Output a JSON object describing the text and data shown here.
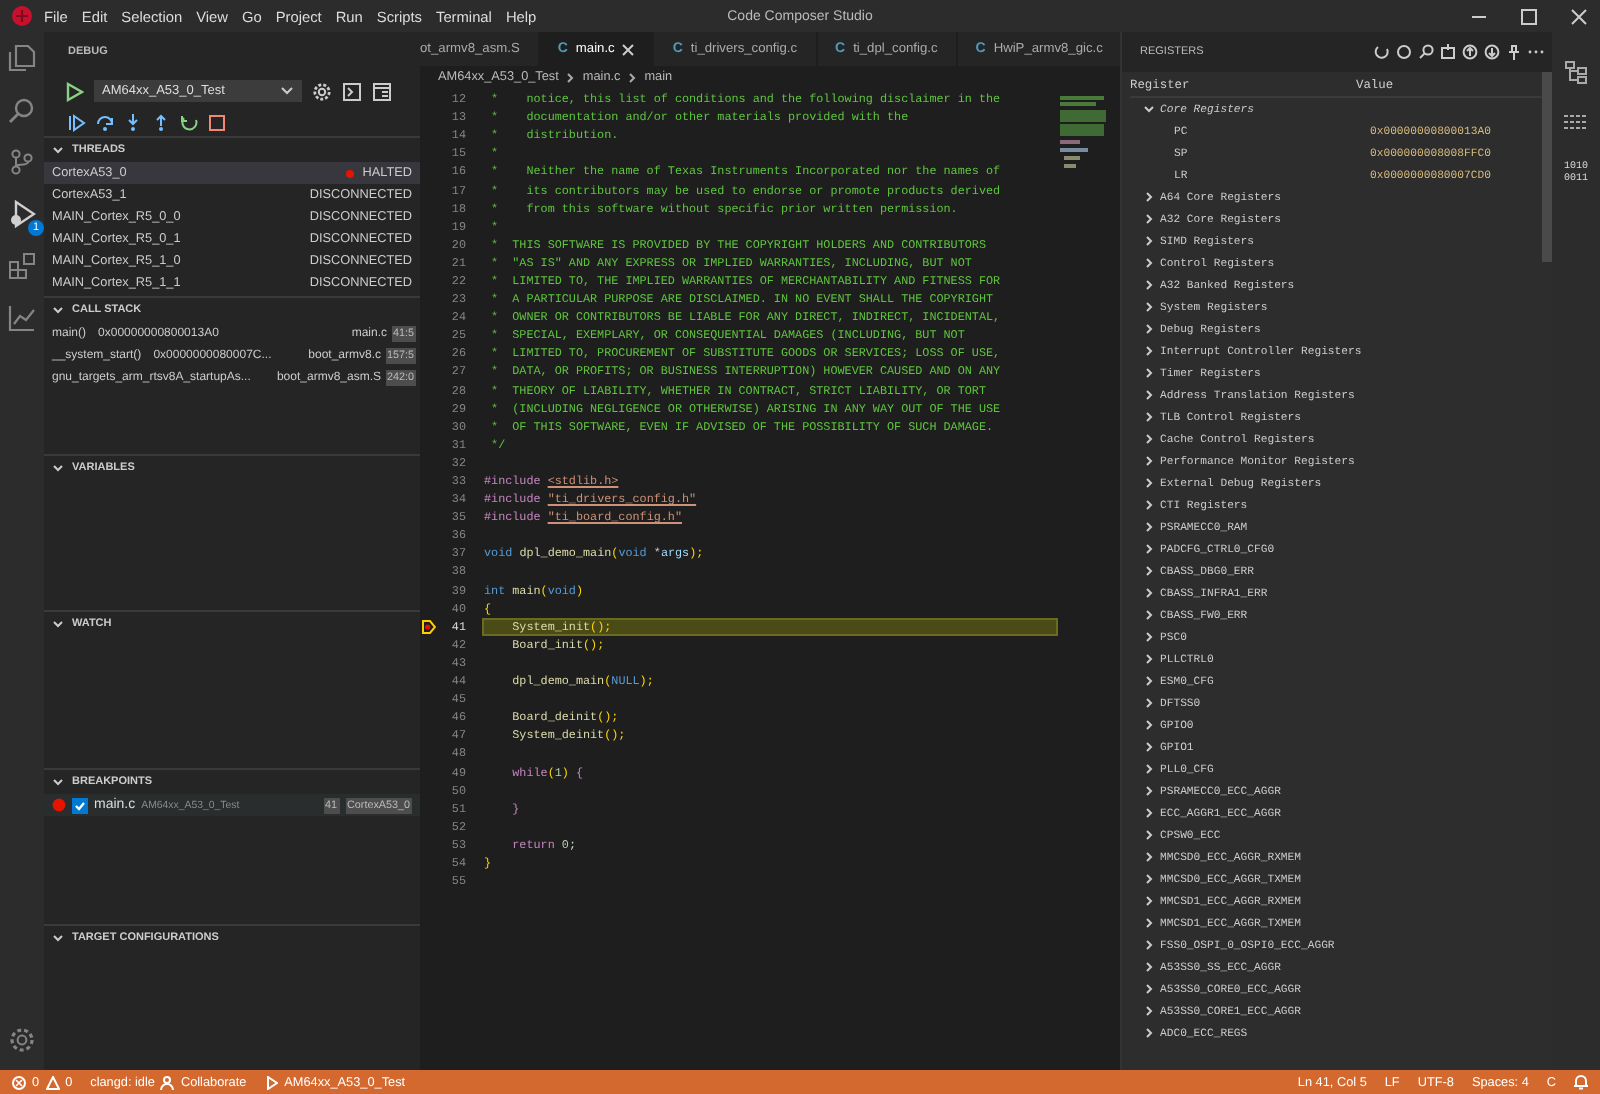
{
  "window": {
    "title": "Code Composer Studio"
  },
  "menu": [
    "File",
    "Edit",
    "Selection",
    "View",
    "Go",
    "Project",
    "Run",
    "Scripts",
    "Terminal",
    "Help"
  ],
  "activity_badge": "1",
  "debug": {
    "title": "DEBUG",
    "config": "AM64xx_A53_0_Test",
    "sections": [
      {
        "kind": "threads",
        "title": "THREADS",
        "expanded": true
      },
      {
        "kind": "callstack",
        "title": "CALL STACK",
        "expanded": true
      },
      {
        "kind": "variables",
        "title": "VARIABLES",
        "expanded": true
      },
      {
        "kind": "watch",
        "title": "WATCH",
        "expanded": true
      },
      {
        "kind": "breakpoints",
        "title": "BREAKPOINTS",
        "expanded": true
      },
      {
        "kind": "targets",
        "title": "TARGET CONFIGURATIONS",
        "expanded": true
      }
    ],
    "threads": [
      {
        "name": "CortexA53_0",
        "status": "HALTED",
        "halted": true,
        "selected": true
      },
      {
        "name": "CortexA53_1",
        "status": "DISCONNECTED",
        "halted": false,
        "selected": false
      },
      {
        "name": "MAIN_Cortex_R5_0_0",
        "status": "DISCONNECTED",
        "halted": false,
        "selected": false
      },
      {
        "name": "MAIN_Cortex_R5_0_1",
        "status": "DISCONNECTED",
        "halted": false,
        "selected": false
      },
      {
        "name": "MAIN_Cortex_R5_1_0",
        "status": "DISCONNECTED",
        "halted": false,
        "selected": false
      },
      {
        "name": "MAIN_Cortex_R5_1_1",
        "status": "DISCONNECTED",
        "halted": false,
        "selected": false
      }
    ],
    "call_stack": [
      {
        "function": "main()",
        "address": "0x00000000800013A0",
        "file": "main.c",
        "position": "41:5"
      },
      {
        "function": "__system_start()",
        "address": "0x0000000080007C...",
        "file": "boot_armv8.c",
        "position": "157:5"
      },
      {
        "function": "gnu_targets_arm_rtsv8A_startupAs...",
        "file": "boot_armv8_asm.S",
        "position": "242:0"
      }
    ],
    "breakpoints": [
      {
        "file": "main.c",
        "project": "AM64xx_A53_0_Test",
        "line": "41",
        "core": "CortexA53_0",
        "checked": true
      }
    ]
  },
  "editor": {
    "tabs": [
      {
        "label": "ot_armv8_asm.S",
        "selected": false
      },
      {
        "label": "main.c",
        "icon": "C",
        "selected": true
      },
      {
        "label": "ti_drivers_config.c",
        "icon": "C",
        "selected": false
      },
      {
        "label": "ti_dpl_config.c",
        "icon": "C",
        "selected": false
      },
      {
        "label": "HwiP_armv8_gic.c",
        "icon": "C",
        "selected": false
      }
    ],
    "breadcrumb": [
      "AM64xx_A53_0_Test",
      "main.c",
      "main"
    ],
    "lines": [
      {
        "number": "12",
        "current": false,
        "tokens": [
          {
            "kind": "comment",
            "text": " *    notice, this list of conditions and the following disclaimer in the"
          }
        ]
      },
      {
        "number": "13",
        "current": false,
        "tokens": [
          {
            "kind": "comment",
            "text": " *    documentation and/or other materials provided with the"
          }
        ]
      },
      {
        "number": "14",
        "current": false,
        "tokens": [
          {
            "kind": "comment",
            "text": " *    distribution."
          }
        ]
      },
      {
        "number": "15",
        "current": false,
        "tokens": [
          {
            "kind": "comment",
            "text": " *"
          }
        ]
      },
      {
        "number": "16",
        "current": false,
        "tokens": [
          {
            "kind": "comment",
            "text": " *    Neither the name of Texas Instruments Incorporated nor the names of"
          }
        ]
      },
      {
        "number": "17",
        "current": false,
        "tokens": [
          {
            "kind": "comment",
            "text": " *    its contributors may be used to endorse or promote products derived"
          }
        ]
      },
      {
        "number": "18",
        "current": false,
        "tokens": [
          {
            "kind": "comment",
            "text": " *    from this software without specific prior written permission."
          }
        ]
      },
      {
        "number": "19",
        "current": false,
        "tokens": [
          {
            "kind": "comment",
            "text": " *"
          }
        ]
      },
      {
        "number": "20",
        "current": false,
        "tokens": [
          {
            "kind": "comment",
            "text": " *  THIS SOFTWARE IS PROVIDED BY THE COPYRIGHT HOLDERS AND CONTRIBUTORS"
          }
        ]
      },
      {
        "number": "21",
        "current": false,
        "tokens": [
          {
            "kind": "comment",
            "text": " *  \"AS IS\" AND ANY EXPRESS OR IMPLIED WARRANTIES, INCLUDING, BUT NOT"
          }
        ]
      },
      {
        "number": "22",
        "current": false,
        "tokens": [
          {
            "kind": "comment",
            "text": " *  LIMITED TO, THE IMPLIED WARRANTIES OF MERCHANTABILITY AND FITNESS FOR"
          }
        ]
      },
      {
        "number": "23",
        "current": false,
        "tokens": [
          {
            "kind": "comment",
            "text": " *  A PARTICULAR PURPOSE ARE DISCLAIMED. IN NO EVENT SHALL THE COPYRIGHT"
          }
        ]
      },
      {
        "number": "24",
        "current": false,
        "tokens": [
          {
            "kind": "comment",
            "text": " *  OWNER OR CONTRIBUTORS BE LIABLE FOR ANY DIRECT, INDIRECT, INCIDENTAL,"
          }
        ]
      },
      {
        "number": "25",
        "current": false,
        "tokens": [
          {
            "kind": "comment",
            "text": " *  SPECIAL, EXEMPLARY, OR CONSEQUENTIAL DAMAGES (INCLUDING, BUT NOT"
          }
        ]
      },
      {
        "number": "26",
        "current": false,
        "tokens": [
          {
            "kind": "comment",
            "text": " *  LIMITED TO, PROCUREMENT OF SUBSTITUTE GOODS OR SERVICES; LOSS OF USE,"
          }
        ]
      },
      {
        "number": "27",
        "current": false,
        "tokens": [
          {
            "kind": "comment",
            "text": " *  DATA, OR PROFITS; OR BUSINESS INTERRUPTION) HOWEVER CAUSED AND ON ANY"
          }
        ]
      },
      {
        "number": "28",
        "current": false,
        "tokens": [
          {
            "kind": "comment",
            "text": " *  THEORY OF LIABILITY, WHETHER IN CONTRACT, STRICT LIABILITY, OR TORT"
          }
        ]
      },
      {
        "number": "29",
        "current": false,
        "tokens": [
          {
            "kind": "comment",
            "text": " *  (INCLUDING NEGLIGENCE OR OTHERWISE) ARISING IN ANY WAY OUT OF THE USE"
          }
        ]
      },
      {
        "number": "30",
        "current": false,
        "tokens": [
          {
            "kind": "comment",
            "text": " *  OF THIS SOFTWARE, EVEN IF ADVISED OF THE POSSIBILITY OF SUCH DAMAGE."
          }
        ]
      },
      {
        "number": "31",
        "current": false,
        "tokens": [
          {
            "kind": "comment",
            "text": " */"
          }
        ]
      },
      {
        "number": "32",
        "current": false
      },
      {
        "number": "33",
        "current": false,
        "tokens": [
          {
            "kind": "preproc",
            "text": "#include "
          },
          {
            "kind": "string",
            "text": "<stdlib.h>"
          }
        ]
      },
      {
        "number": "34",
        "current": false,
        "tokens": [
          {
            "kind": "preproc",
            "text": "#include "
          },
          {
            "kind": "string",
            "text": "\"ti_drivers_config.h\""
          }
        ]
      },
      {
        "number": "35",
        "current": false,
        "tokens": [
          {
            "kind": "preproc",
            "text": "#include "
          },
          {
            "kind": "string",
            "text": "\"ti_board_config.h\""
          }
        ]
      },
      {
        "number": "36",
        "current": false
      },
      {
        "number": "37",
        "current": false,
        "tokens": [
          {
            "kind": "keyword",
            "text": "void "
          },
          {
            "kind": "function",
            "text": "dpl_demo_main"
          },
          {
            "kind": "punct",
            "text": "("
          },
          {
            "kind": "keyword",
            "text": "void "
          },
          {
            "kind": "plain",
            "text": "*"
          },
          {
            "kind": "var",
            "text": "args"
          },
          {
            "kind": "punct",
            "text": ");"
          }
        ]
      },
      {
        "number": "38",
        "current": false
      },
      {
        "number": "39",
        "current": false,
        "tokens": [
          {
            "kind": "keyword",
            "text": "int "
          },
          {
            "kind": "function",
            "text": "main"
          },
          {
            "kind": "punct",
            "text": "("
          },
          {
            "kind": "keyword",
            "text": "void"
          },
          {
            "kind": "punct",
            "text": ")"
          }
        ]
      },
      {
        "number": "40",
        "current": false,
        "tokens": [
          {
            "kind": "punct",
            "text": "{"
          }
        ]
      },
      {
        "number": "41",
        "current": true,
        "tokens": [
          {
            "kind": "function",
            "text": "    System_init"
          },
          {
            "kind": "punct",
            "text": "();"
          }
        ]
      },
      {
        "number": "42",
        "current": false,
        "tokens": [
          {
            "kind": "function",
            "text": "    Board_init"
          },
          {
            "kind": "punct",
            "text": "();"
          }
        ]
      },
      {
        "number": "43",
        "current": false
      },
      {
        "number": "44",
        "current": false,
        "tokens": [
          {
            "kind": "function",
            "text": "    dpl_demo_main"
          },
          {
            "kind": "punct",
            "text": "("
          },
          {
            "kind": "keyword",
            "text": "NULL"
          },
          {
            "kind": "punct",
            "text": ");"
          }
        ]
      },
      {
        "number": "45",
        "current": false
      },
      {
        "number": "46",
        "current": false,
        "tokens": [
          {
            "kind": "function",
            "text": "    Board_deinit"
          },
          {
            "kind": "punct",
            "text": "();"
          }
        ]
      },
      {
        "number": "47",
        "current": false,
        "tokens": [
          {
            "kind": "function",
            "text": "    System_deinit"
          },
          {
            "kind": "punct",
            "text": "();"
          }
        ]
      },
      {
        "number": "48",
        "current": false
      },
      {
        "number": "49",
        "current": false,
        "tokens": [
          {
            "kind": "control",
            "text": "    while"
          },
          {
            "kind": "punct",
            "text": "("
          },
          {
            "kind": "number",
            "text": "1"
          },
          {
            "kind": "punct",
            "text": ")"
          },
          {
            "kind": "control",
            "text": " {"
          }
        ]
      },
      {
        "number": "50",
        "current": false
      },
      {
        "number": "51",
        "current": false,
        "tokens": [
          {
            "kind": "control",
            "text": "    }"
          }
        ]
      },
      {
        "number": "52",
        "current": false
      },
      {
        "number": "53",
        "current": false,
        "tokens": [
          {
            "kind": "control",
            "text": "    return "
          },
          {
            "kind": "number",
            "text": "0"
          },
          {
            "kind": "plain",
            "text": ";"
          }
        ]
      },
      {
        "number": "54",
        "current": false,
        "tokens": [
          {
            "kind": "punct",
            "text": "}"
          }
        ]
      },
      {
        "number": "55",
        "current": false
      }
    ]
  },
  "registers": {
    "title": "REGISTERS",
    "columns": [
      "Register",
      "Value"
    ],
    "groups": [
      {
        "name": "Core Registers",
        "expanded": true,
        "children": [
          {
            "name": "PC",
            "value": "0x00000000800013A0"
          },
          {
            "name": "SP",
            "value": "0x000000008008FFC0"
          },
          {
            "name": "LR",
            "value": "0x0000000080007CD0"
          }
        ]
      },
      {
        "name": "A64 Core Registers",
        "expanded": false
      },
      {
        "name": "A32 Core Registers",
        "expanded": false
      },
      {
        "name": "SIMD Registers",
        "expanded": false
      },
      {
        "name": "Control Registers",
        "expanded": false
      },
      {
        "name": "A32 Banked Registers",
        "expanded": false
      },
      {
        "name": "System Registers",
        "expanded": false
      },
      {
        "name": "Debug Registers",
        "expanded": false
      },
      {
        "name": "Interrupt Controller Registers",
        "expanded": false
      },
      {
        "name": "Timer Registers",
        "expanded": false
      },
      {
        "name": "Address Translation Registers",
        "expanded": false
      },
      {
        "name": "TLB Control Registers",
        "expanded": false
      },
      {
        "name": "Cache Control Registers",
        "expanded": false
      },
      {
        "name": "Performance Monitor Registers",
        "expanded": false
      },
      {
        "name": "External Debug Registers",
        "expanded": false
      },
      {
        "name": "CTI Registers",
        "expanded": false
      },
      {
        "name": "PSRAMECC0_RAM",
        "expanded": false
      },
      {
        "name": "PADCFG_CTRL0_CFG0",
        "expanded": false
      },
      {
        "name": "CBASS_DBG0_ERR",
        "expanded": false
      },
      {
        "name": "CBASS_INFRA1_ERR",
        "expanded": false
      },
      {
        "name": "CBASS_FW0_ERR",
        "expanded": false
      },
      {
        "name": "PSC0",
        "expanded": false
      },
      {
        "name": "PLLCTRL0",
        "expanded": false
      },
      {
        "name": "ESM0_CFG",
        "expanded": false
      },
      {
        "name": "DFTSS0",
        "expanded": false
      },
      {
        "name": "GPIO0",
        "expanded": false
      },
      {
        "name": "GPIO1",
        "expanded": false
      },
      {
        "name": "PLL0_CFG",
        "expanded": false
      },
      {
        "name": "PSRAMECC0_ECC_AGGR",
        "expanded": false
      },
      {
        "name": "ECC_AGGR1_ECC_AGGR",
        "expanded": false
      },
      {
        "name": "CPSW0_ECC",
        "expanded": false
      },
      {
        "name": "MMCSD0_ECC_AGGR_RXMEM",
        "expanded": false
      },
      {
        "name": "MMCSD0_ECC_AGGR_TXMEM",
        "expanded": false
      },
      {
        "name": "MMCSD1_ECC_AGGR_RXMEM",
        "expanded": false
      },
      {
        "name": "MMCSD1_ECC_AGGR_TXMEM",
        "expanded": false
      },
      {
        "name": "FSS0_OSPI_0_OSPI0_ECC_AGGR",
        "expanded": false
      },
      {
        "name": "A53SS0_SS_ECC_AGGR",
        "expanded": false
      },
      {
        "name": "A53SS0_CORE0_ECC_AGGR",
        "expanded": false
      },
      {
        "name": "A53SS0_CORE1_ECC_AGGR",
        "expanded": false
      },
      {
        "name": "ADC0_ECC_REGS",
        "expanded": false
      }
    ]
  },
  "right_bar": {
    "memory_label": [
      "1010",
      "0011"
    ]
  },
  "status_bar": {
    "errors": "0",
    "warnings": "0",
    "left": [
      "clangd: idle",
      "Collaborate",
      "AM64xx_A53_0_Test"
    ],
    "right": [
      "Ln 41, Col 5",
      "LF",
      "UTF-8",
      "Spaces: 4",
      "C"
    ]
  }
}
